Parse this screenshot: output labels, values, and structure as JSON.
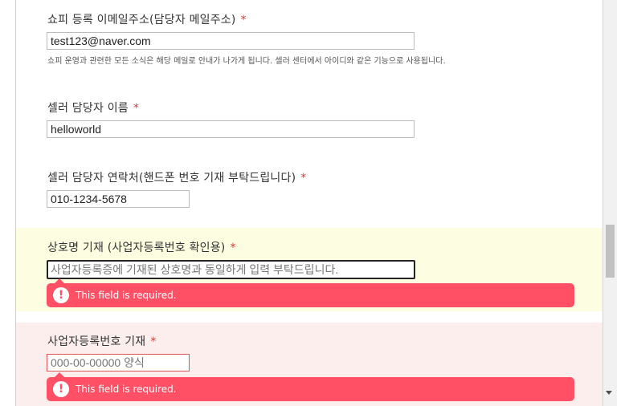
{
  "fields": [
    {
      "label": "쇼피 등록 이메일주소(담당자 메일주소)",
      "required_mark": "*",
      "value": "test123@naver.com",
      "hint": "쇼피 운영과 관련한 모든 소식은 해당 메일로 안내가 나가게 됩니다. 셀러 센터에서 아이디와 같은 기능으로 사용됩니다."
    },
    {
      "label": "셀러 담당자 이름",
      "required_mark": "*",
      "value": "helloworld"
    },
    {
      "label": "셀러 담당자 연락처(핸드폰 번호 기재 부탁드립니다)",
      "required_mark": "*",
      "value": "010-1234-5678"
    },
    {
      "label": "상호명 기재 (사업자등록번호 확인용)",
      "required_mark": "*",
      "value": "",
      "placeholder": "사업자등록증에 기재된 상호명과 동일하게 입력 부탁드립니다.",
      "state": "focused-error",
      "error": "This field is required."
    },
    {
      "label": "사업자등록번호 기재",
      "required_mark": "*",
      "value": "",
      "placeholder": "000-00-00000 양식",
      "state": "error",
      "error": "This field is required."
    }
  ],
  "icons": {
    "error_badge": "exclamation-icon",
    "error_badge_glyph": "!",
    "scroll_down": "chevron-down-icon"
  },
  "colors": {
    "required": "#d63a3a",
    "error_bg": "#ff5065",
    "yellow_highlight": "#fdfde1",
    "red_highlight": "#fdeeee"
  }
}
